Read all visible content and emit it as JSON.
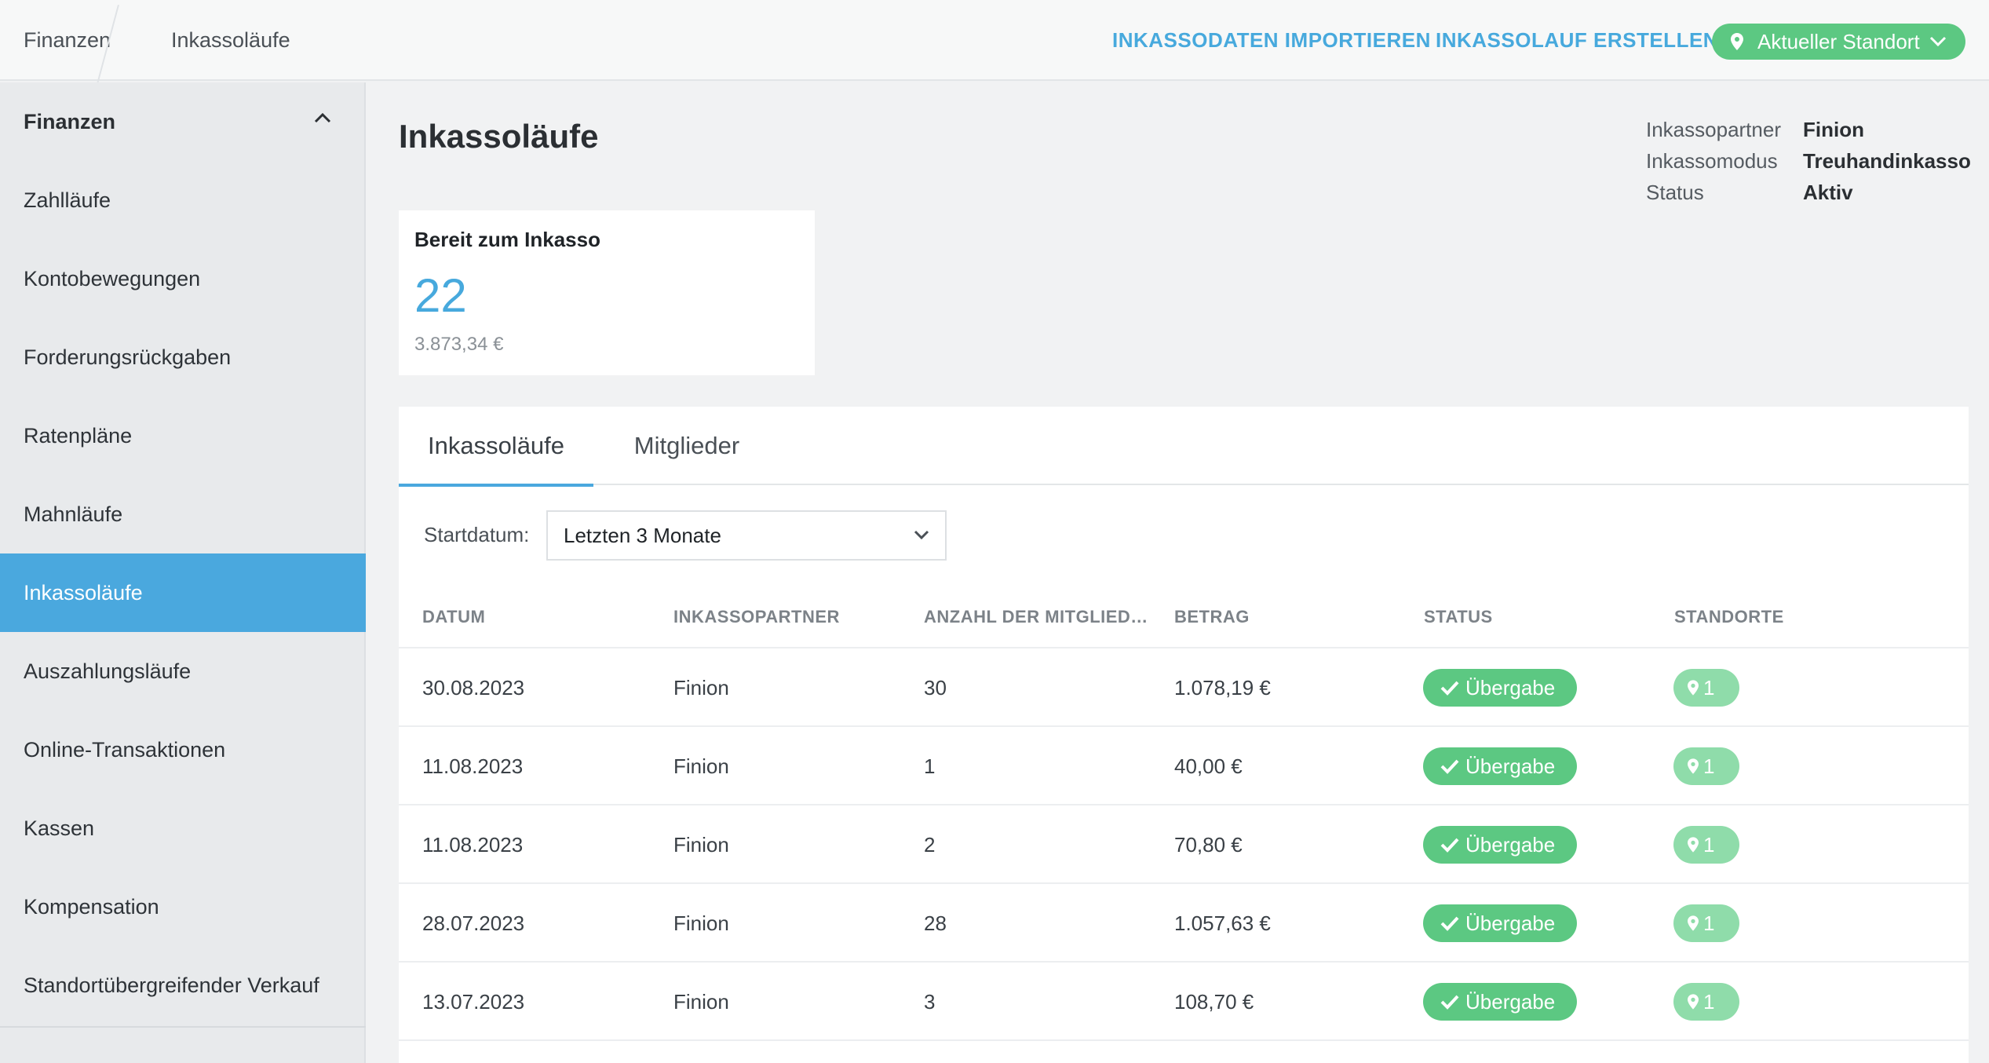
{
  "breadcrumb": {
    "items": [
      "Finanzen",
      "Inkassoläufe"
    ]
  },
  "top_actions": {
    "import_label": "INKASSODATEN IMPORTIEREN",
    "create_label": "INKASSOLAUF ERSTELLEN",
    "location_label": "Aktueller Standort",
    "location_icon": "map-pin-icon"
  },
  "sidebar": {
    "section_title": "Finanzen",
    "items": [
      {
        "label": "Zahlläufe"
      },
      {
        "label": "Kontobewegungen"
      },
      {
        "label": "Forderungsrückgaben"
      },
      {
        "label": "Ratenpläne"
      },
      {
        "label": "Mahnläufe"
      },
      {
        "label": "Inkassoläufe",
        "active": true
      },
      {
        "label": "Auszahlungsläufe"
      },
      {
        "label": "Online-Transaktionen"
      },
      {
        "label": "Kassen"
      },
      {
        "label": "Kompensation"
      },
      {
        "label": "Standortübergreifender Verkauf"
      }
    ]
  },
  "page": {
    "title": "Inkassoläufe",
    "meta": [
      {
        "key": "Inkassopartner",
        "value": "Finion"
      },
      {
        "key": "Inkassomodus",
        "value": "Treuhandinkasso"
      },
      {
        "key": "Status",
        "value": "Aktiv"
      }
    ]
  },
  "summary_card": {
    "title": "Bereit zum Inkasso",
    "count": "22",
    "amount": "3.873,34 €"
  },
  "tabs": [
    {
      "label": "Inkassoläufe",
      "active": true
    },
    {
      "label": "Mitglieder"
    }
  ],
  "filter": {
    "label": "Startdatum:",
    "selected": "Letzten 3 Monate"
  },
  "table": {
    "headers": [
      "DATUM",
      "INKASSOPARTNER",
      "ANZAHL DER MITGLIED…",
      "BETRAG",
      "STATUS",
      "STANDORTE"
    ],
    "rows": [
      {
        "date": "30.08.2023",
        "partner": "Finion",
        "count": "30",
        "amount": "1.078,19 €",
        "status": "Übergabe",
        "locations": "1"
      },
      {
        "date": "11.08.2023",
        "partner": "Finion",
        "count": "1",
        "amount": "40,00 €",
        "status": "Übergabe",
        "locations": "1"
      },
      {
        "date": "11.08.2023",
        "partner": "Finion",
        "count": "2",
        "amount": "70,80 €",
        "status": "Übergabe",
        "locations": "1"
      },
      {
        "date": "28.07.2023",
        "partner": "Finion",
        "count": "28",
        "amount": "1.057,63 €",
        "status": "Übergabe",
        "locations": "1"
      },
      {
        "date": "13.07.2023",
        "partner": "Finion",
        "count": "3",
        "amount": "108,70 €",
        "status": "Übergabe",
        "locations": "1"
      }
    ]
  },
  "colors": {
    "accent": "#47a9dd",
    "active_nav": "#4aa8de",
    "success": "#5cc882",
    "success_light": "#8fdcaa"
  }
}
